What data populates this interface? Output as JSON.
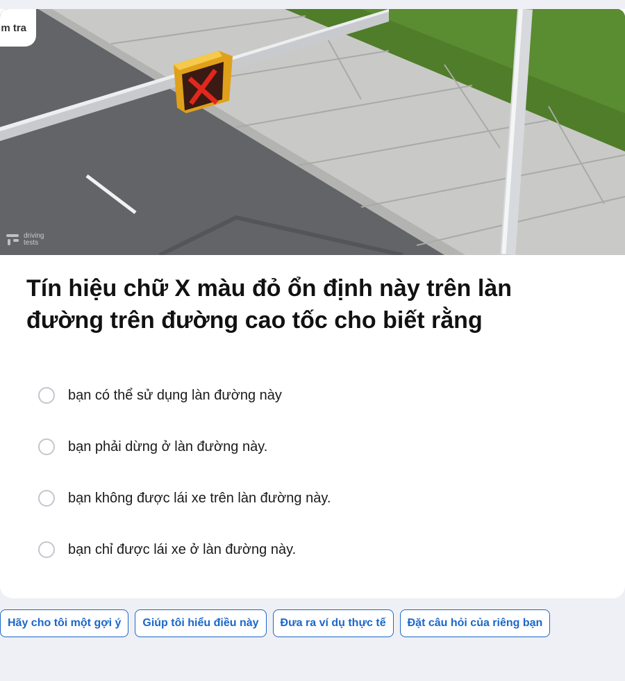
{
  "header": {
    "tab_label": "m tra"
  },
  "image": {
    "watermark_line1": "driving",
    "watermark_line2": "tests"
  },
  "question": {
    "text": "Tín hiệu chữ X màu đỏ ổn định này trên làn đường trên đường cao tốc cho biết rằng"
  },
  "options": [
    {
      "label": "bạn có thể sử dụng làn đường này"
    },
    {
      "label": "bạn phải dừng ở làn đường này."
    },
    {
      "label": "bạn không được lái xe trên làn đường này."
    },
    {
      "label": "bạn chỉ được lái xe ở làn đường này."
    }
  ],
  "actions": [
    {
      "label": "Hãy cho tôi một gợi ý"
    },
    {
      "label": "Giúp tôi hiểu điều này"
    },
    {
      "label": "Đưa ra ví dụ thực tế"
    },
    {
      "label": "Đặt câu hỏi của riêng bạn"
    }
  ],
  "colors": {
    "accent": "#1b67c9",
    "background": "#eff0f5",
    "signal_red": "#d8261c",
    "signal_housing": "#f0b21e"
  }
}
